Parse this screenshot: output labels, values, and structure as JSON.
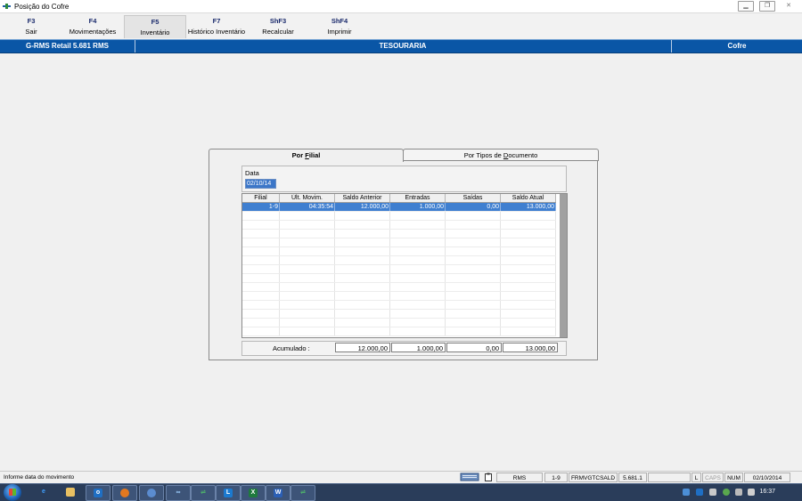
{
  "window": {
    "title": "Posição do Cofre"
  },
  "toolbar": {
    "keys": [
      {
        "key": "F3",
        "label": "Sair"
      },
      {
        "key": "F4",
        "label": "Movimentações"
      },
      {
        "key": "F5",
        "label": "Inventário"
      },
      {
        "key": "F7",
        "label": "Histórico Inventário"
      },
      {
        "key": "ShF3",
        "label": "Recalcular"
      },
      {
        "key": "ShF4",
        "label": "Imprimir"
      }
    ]
  },
  "header": {
    "app": "G-RMS Retail 5.681 RMS",
    "section": "TESOURARIA",
    "context": "Cofre"
  },
  "tabs": {
    "active": "Por Filial",
    "active_hotkey": "F",
    "inactive": "Por Tipos de Documento",
    "inactive_hotkey": "D"
  },
  "date_field": {
    "label": "Data",
    "value": "02/10/14"
  },
  "grid": {
    "columns": [
      "Filial",
      "Últ. Movim.",
      "Saldo Anterior",
      "Entradas",
      "Saídas",
      "Saldo Atual"
    ],
    "rows": [
      [
        "1-9",
        "04:35:54",
        "12.000,00",
        "1.000,00",
        "0,00",
        "13.000,00"
      ]
    ]
  },
  "totals": {
    "label": "Acumulado :",
    "saldo_anterior": "12.000,00",
    "entradas": "1.000,00",
    "saidas": "0,00",
    "saldo_atual": "13.000,00"
  },
  "statusbar": {
    "message": "Informe data do movimento",
    "cells": [
      "RMS",
      "1-9",
      "FRMVGTCSALD",
      "5.681.1",
      "",
      "L",
      "CAPS",
      "NUM",
      "02/10/2014"
    ]
  },
  "taskbar": {
    "clock": "16:37"
  },
  "colors": {
    "header_blue": "#0a56a6",
    "selection_blue": "#3f7fd0",
    "taskbar": "#2a3d5a"
  }
}
